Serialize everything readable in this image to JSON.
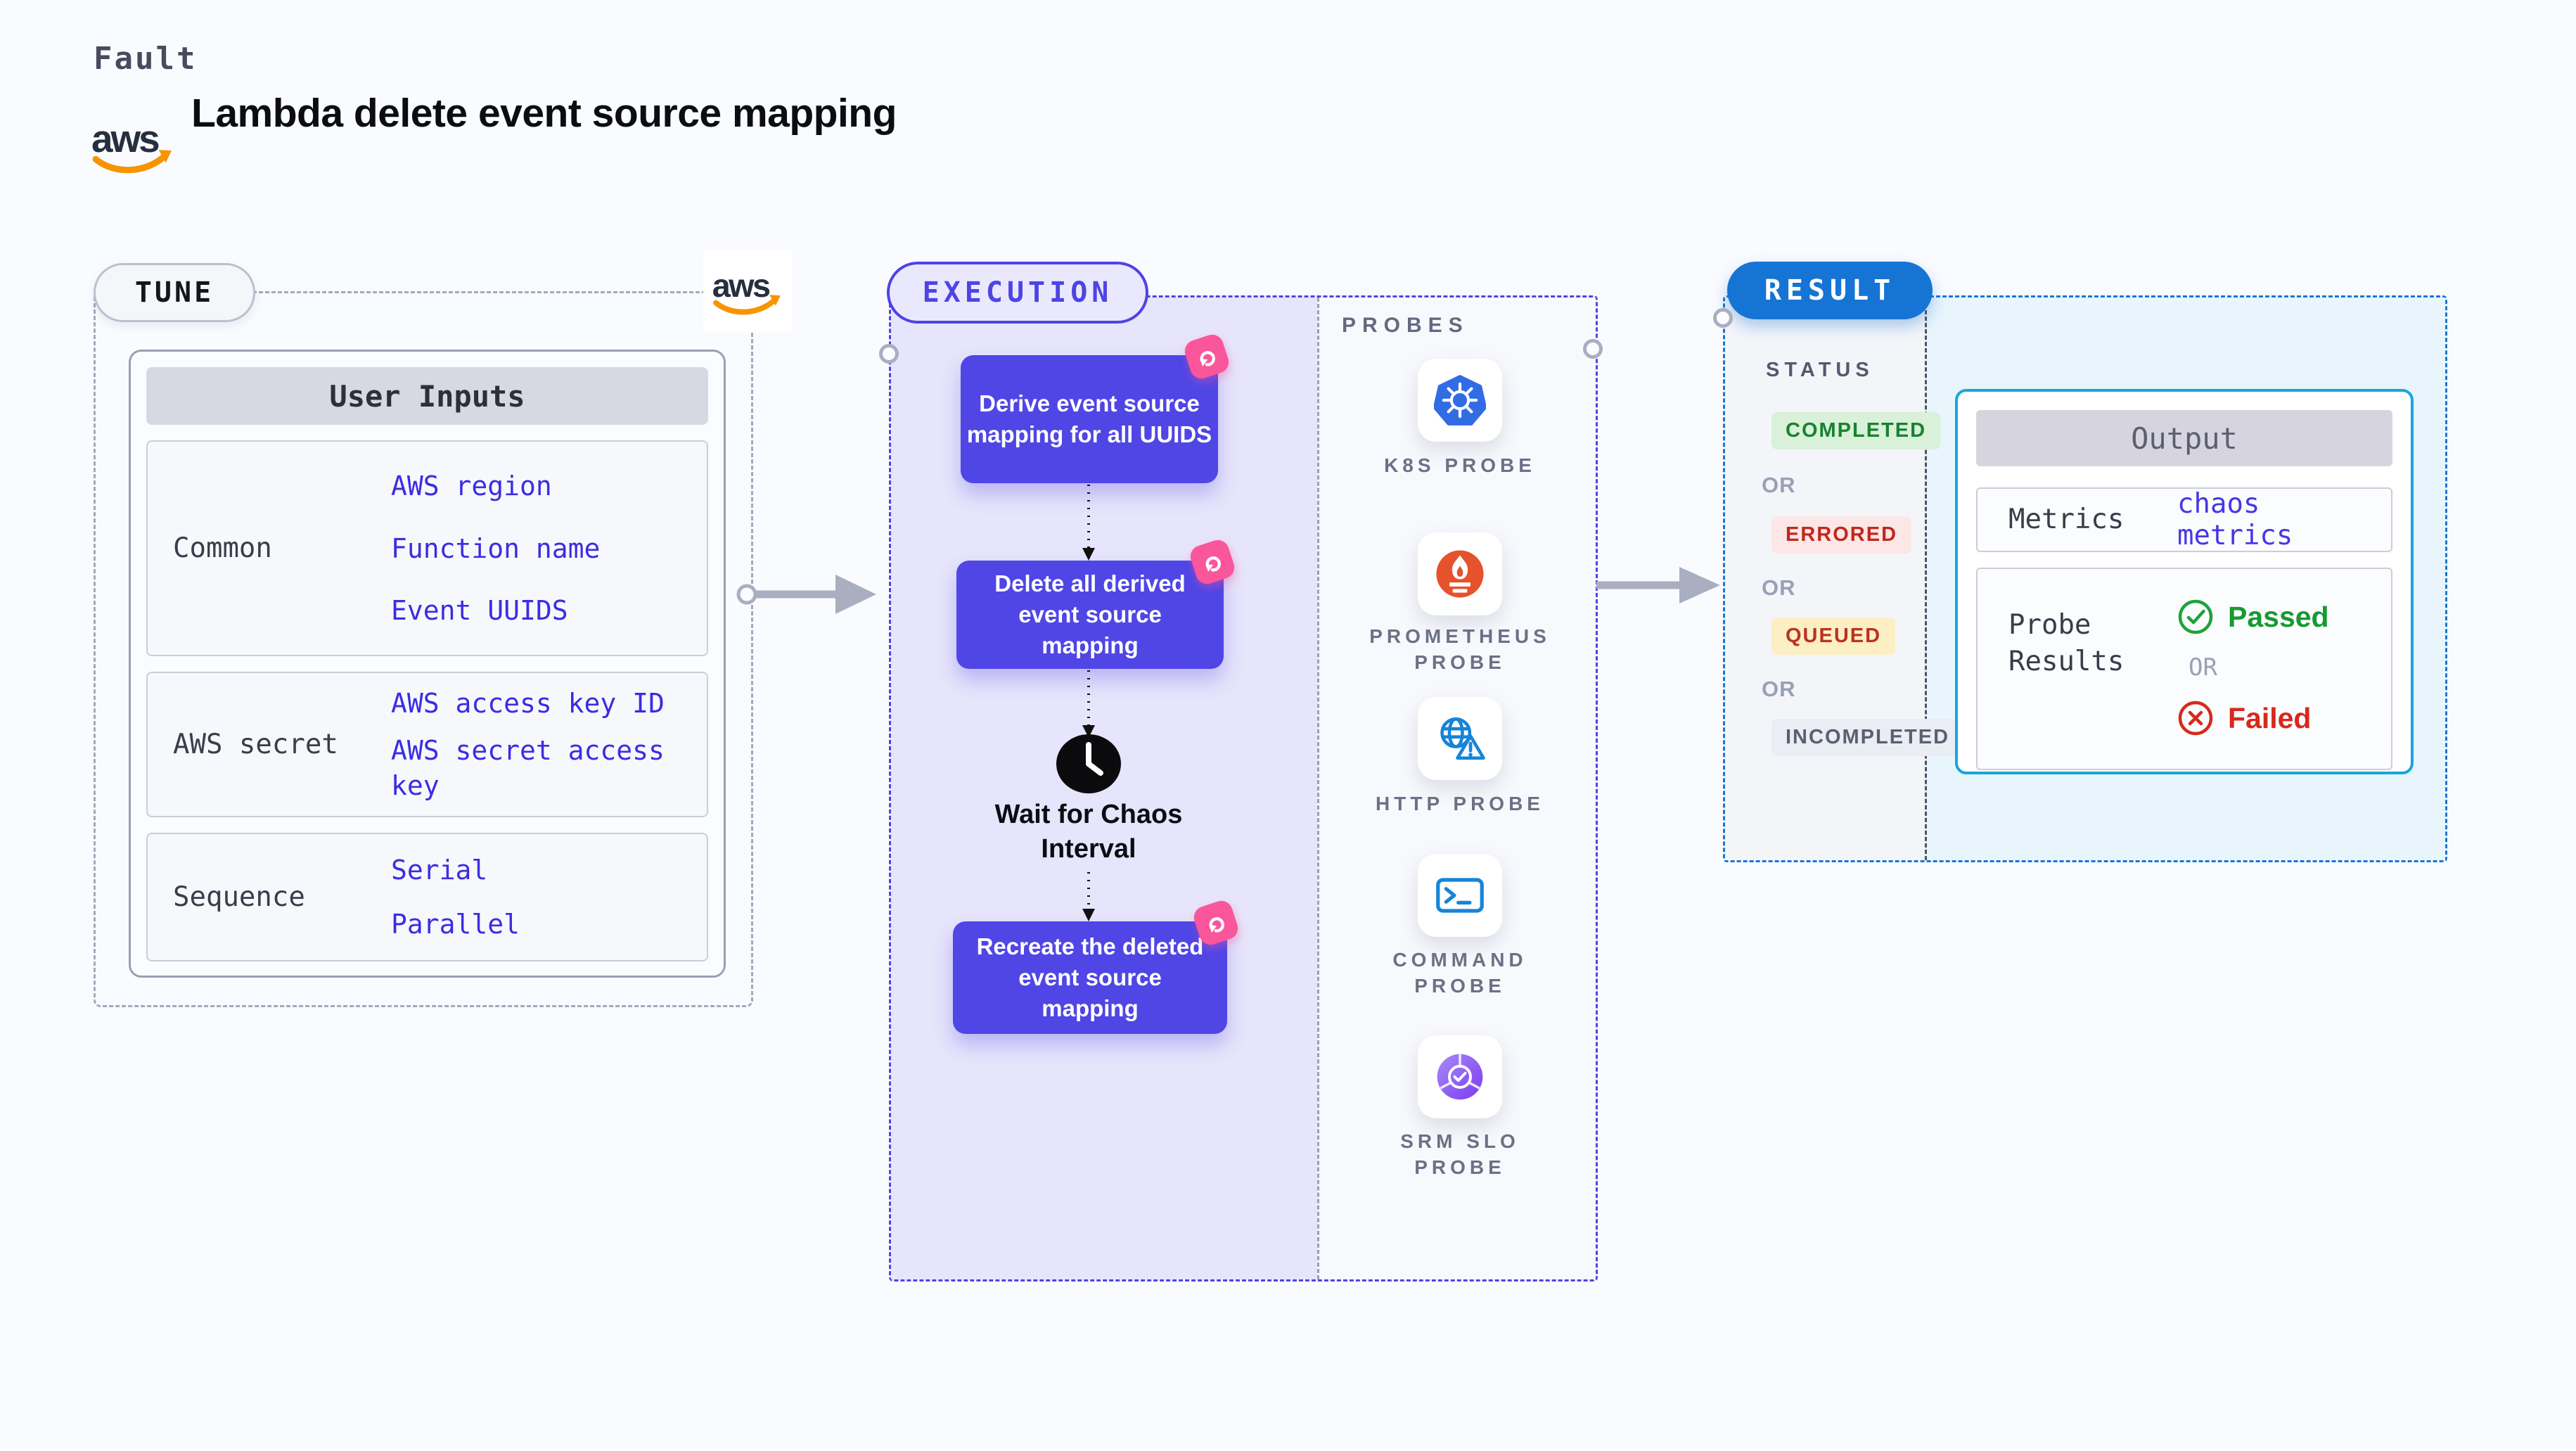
{
  "header": {
    "kicker": "Fault",
    "title": "Lambda delete event source mapping",
    "aws_wordmark": "aws"
  },
  "tune": {
    "pill": "TUNE",
    "table_title": "User Inputs",
    "rows": [
      {
        "label": "Common",
        "options": [
          "AWS region",
          "Function name",
          "Event UUIDS"
        ]
      },
      {
        "label": "AWS secret",
        "options": [
          "AWS access key ID",
          "AWS secret access key"
        ]
      },
      {
        "label": "Sequence",
        "options": [
          "Serial",
          "Parallel"
        ]
      }
    ]
  },
  "execution": {
    "pill": "EXECUTION",
    "node1": {
      "lines": [
        "Derive event source",
        "mapping for all UUIDS"
      ]
    },
    "node2": {
      "lines": [
        "Delete all derived",
        "event source",
        "mapping"
      ]
    },
    "wait": {
      "lines": [
        "Wait for Chaos",
        "Interval"
      ]
    },
    "node3": {
      "lines": [
        "Recreate the deleted",
        "event source",
        "mapping"
      ]
    }
  },
  "probes": {
    "heading": "PROBES",
    "items": [
      {
        "icon": "kubernetes-icon",
        "lines": [
          "K8S PROBE"
        ]
      },
      {
        "icon": "prometheus-icon",
        "lines": [
          "PROMETHEUS",
          "PROBE"
        ]
      },
      {
        "icon": "http-globe-warning-icon",
        "lines": [
          "HTTP PROBE"
        ]
      },
      {
        "icon": "terminal-icon",
        "lines": [
          "COMMAND",
          "PROBE"
        ]
      },
      {
        "icon": "srm-slo-gauge-icon",
        "lines": [
          "SRM SLO",
          "PROBE"
        ]
      }
    ]
  },
  "result": {
    "pill": "RESULT",
    "status_heading": "STATUS",
    "or_label": "OR",
    "statuses": [
      {
        "label": "COMPLETED",
        "fg": "#19822f",
        "bg": "#d9f0d9"
      },
      {
        "label": "ERRORED",
        "fg": "#c2271d",
        "bg": "#fbe7e6"
      },
      {
        "label": "QUEUED",
        "fg": "#bb3222",
        "bg": "#fcefc4"
      },
      {
        "label": "INCOMPLETED",
        "fg": "#596070",
        "bg": "#ebedf4"
      }
    ],
    "output": {
      "title": "Output",
      "metrics_label": "Metrics",
      "metrics_value": "chaos metrics",
      "probe_results_lines": [
        "Probe",
        "Results"
      ],
      "passed_label": "Passed",
      "or_label": "OR",
      "failed_label": "Failed"
    }
  },
  "colors": {
    "accent_indigo": "#4f46e5",
    "execution_bg": "#e7e5fb",
    "accent_blue": "#1674d4",
    "output_border_cyan": "#17a6dd",
    "result_bg_cyan": "#e8f5fc",
    "link_blue": "#3b2de2",
    "badge_pink": "#f9569b",
    "aws_orange": "#f79400",
    "success_green": "#169a31",
    "error_red": "#d8281c",
    "k8s_blue": "#326ce5",
    "prometheus_orange": "#e6522c"
  }
}
